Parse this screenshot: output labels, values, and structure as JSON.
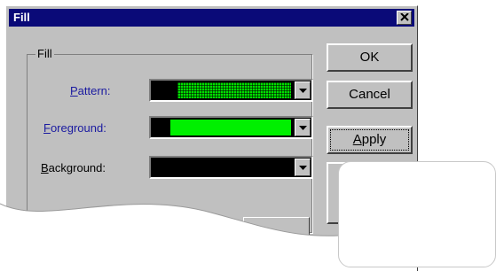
{
  "window": {
    "title": "Fill"
  },
  "group": {
    "label": "Fill",
    "pattern": {
      "label_hot": "P",
      "label_rest": "attern:"
    },
    "foreground": {
      "label_hot": "F",
      "label_rest": "oreground:"
    },
    "background": {
      "label_hot": "B",
      "label_rest": "ackground:"
    }
  },
  "buttons": {
    "ok": "OK",
    "cancel": "Cancel",
    "apply_hot": "A",
    "apply_rest": "pply"
  },
  "colors": {
    "titlebar": "#0a0a78",
    "dialog_face": "#c0c0c0",
    "pattern_fg": "#00e000",
    "foreground_swatch": "#00f000",
    "background_swatch": "#000000",
    "hotkey_label": "#1a1aa0"
  },
  "icons": {
    "close": "close-icon",
    "dropdown": "chevron-down-icon"
  }
}
